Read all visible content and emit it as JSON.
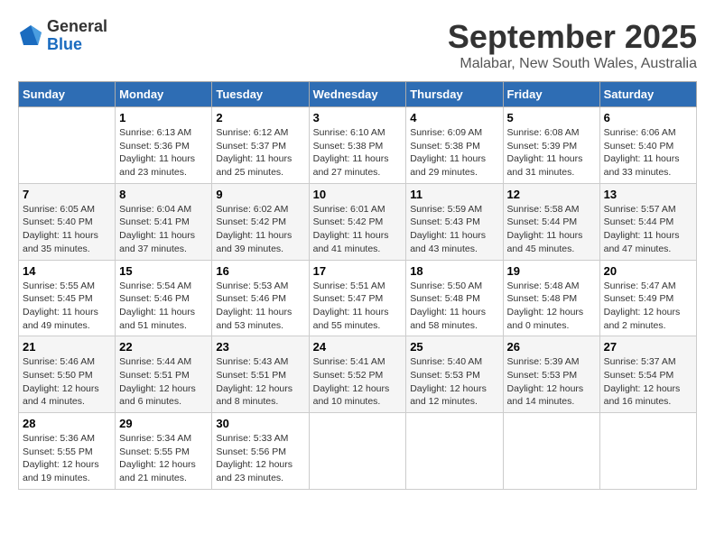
{
  "header": {
    "logo": {
      "general": "General",
      "blue": "Blue"
    },
    "title": "September 2025",
    "location": "Malabar, New South Wales, Australia"
  },
  "days_of_week": [
    "Sunday",
    "Monday",
    "Tuesday",
    "Wednesday",
    "Thursday",
    "Friday",
    "Saturday"
  ],
  "weeks": [
    [
      {
        "day": "",
        "info": ""
      },
      {
        "day": "1",
        "info": "Sunrise: 6:13 AM\nSunset: 5:36 PM\nDaylight: 11 hours\nand 23 minutes."
      },
      {
        "day": "2",
        "info": "Sunrise: 6:12 AM\nSunset: 5:37 PM\nDaylight: 11 hours\nand 25 minutes."
      },
      {
        "day": "3",
        "info": "Sunrise: 6:10 AM\nSunset: 5:38 PM\nDaylight: 11 hours\nand 27 minutes."
      },
      {
        "day": "4",
        "info": "Sunrise: 6:09 AM\nSunset: 5:38 PM\nDaylight: 11 hours\nand 29 minutes."
      },
      {
        "day": "5",
        "info": "Sunrise: 6:08 AM\nSunset: 5:39 PM\nDaylight: 11 hours\nand 31 minutes."
      },
      {
        "day": "6",
        "info": "Sunrise: 6:06 AM\nSunset: 5:40 PM\nDaylight: 11 hours\nand 33 minutes."
      }
    ],
    [
      {
        "day": "7",
        "info": "Sunrise: 6:05 AM\nSunset: 5:40 PM\nDaylight: 11 hours\nand 35 minutes."
      },
      {
        "day": "8",
        "info": "Sunrise: 6:04 AM\nSunset: 5:41 PM\nDaylight: 11 hours\nand 37 minutes."
      },
      {
        "day": "9",
        "info": "Sunrise: 6:02 AM\nSunset: 5:42 PM\nDaylight: 11 hours\nand 39 minutes."
      },
      {
        "day": "10",
        "info": "Sunrise: 6:01 AM\nSunset: 5:42 PM\nDaylight: 11 hours\nand 41 minutes."
      },
      {
        "day": "11",
        "info": "Sunrise: 5:59 AM\nSunset: 5:43 PM\nDaylight: 11 hours\nand 43 minutes."
      },
      {
        "day": "12",
        "info": "Sunrise: 5:58 AM\nSunset: 5:44 PM\nDaylight: 11 hours\nand 45 minutes."
      },
      {
        "day": "13",
        "info": "Sunrise: 5:57 AM\nSunset: 5:44 PM\nDaylight: 11 hours\nand 47 minutes."
      }
    ],
    [
      {
        "day": "14",
        "info": "Sunrise: 5:55 AM\nSunset: 5:45 PM\nDaylight: 11 hours\nand 49 minutes."
      },
      {
        "day": "15",
        "info": "Sunrise: 5:54 AM\nSunset: 5:46 PM\nDaylight: 11 hours\nand 51 minutes."
      },
      {
        "day": "16",
        "info": "Sunrise: 5:53 AM\nSunset: 5:46 PM\nDaylight: 11 hours\nand 53 minutes."
      },
      {
        "day": "17",
        "info": "Sunrise: 5:51 AM\nSunset: 5:47 PM\nDaylight: 11 hours\nand 55 minutes."
      },
      {
        "day": "18",
        "info": "Sunrise: 5:50 AM\nSunset: 5:48 PM\nDaylight: 11 hours\nand 58 minutes."
      },
      {
        "day": "19",
        "info": "Sunrise: 5:48 AM\nSunset: 5:48 PM\nDaylight: 12 hours\nand 0 minutes."
      },
      {
        "day": "20",
        "info": "Sunrise: 5:47 AM\nSunset: 5:49 PM\nDaylight: 12 hours\nand 2 minutes."
      }
    ],
    [
      {
        "day": "21",
        "info": "Sunrise: 5:46 AM\nSunset: 5:50 PM\nDaylight: 12 hours\nand 4 minutes."
      },
      {
        "day": "22",
        "info": "Sunrise: 5:44 AM\nSunset: 5:51 PM\nDaylight: 12 hours\nand 6 minutes."
      },
      {
        "day": "23",
        "info": "Sunrise: 5:43 AM\nSunset: 5:51 PM\nDaylight: 12 hours\nand 8 minutes."
      },
      {
        "day": "24",
        "info": "Sunrise: 5:41 AM\nSunset: 5:52 PM\nDaylight: 12 hours\nand 10 minutes."
      },
      {
        "day": "25",
        "info": "Sunrise: 5:40 AM\nSunset: 5:53 PM\nDaylight: 12 hours\nand 12 minutes."
      },
      {
        "day": "26",
        "info": "Sunrise: 5:39 AM\nSunset: 5:53 PM\nDaylight: 12 hours\nand 14 minutes."
      },
      {
        "day": "27",
        "info": "Sunrise: 5:37 AM\nSunset: 5:54 PM\nDaylight: 12 hours\nand 16 minutes."
      }
    ],
    [
      {
        "day": "28",
        "info": "Sunrise: 5:36 AM\nSunset: 5:55 PM\nDaylight: 12 hours\nand 19 minutes."
      },
      {
        "day": "29",
        "info": "Sunrise: 5:34 AM\nSunset: 5:55 PM\nDaylight: 12 hours\nand 21 minutes."
      },
      {
        "day": "30",
        "info": "Sunrise: 5:33 AM\nSunset: 5:56 PM\nDaylight: 12 hours\nand 23 minutes."
      },
      {
        "day": "",
        "info": ""
      },
      {
        "day": "",
        "info": ""
      },
      {
        "day": "",
        "info": ""
      },
      {
        "day": "",
        "info": ""
      }
    ]
  ]
}
